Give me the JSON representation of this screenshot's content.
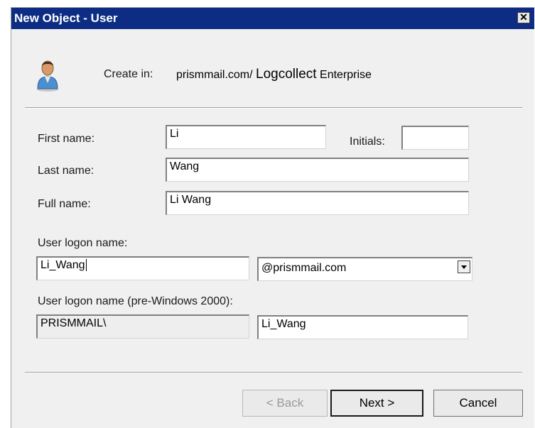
{
  "window": {
    "title": "New Object - User",
    "close_glyph": "✕"
  },
  "header": {
    "icon": "user-icon",
    "create_in_label": "Create in:",
    "path_prefix": "prismmail.com/",
    "path_ou": "Logcollect",
    "path_suffix": "Enterprise"
  },
  "form": {
    "first_name_label": "First name:",
    "first_name_value": "Li",
    "initials_label": "Initials:",
    "initials_value": "",
    "last_name_label": "Last name:",
    "last_name_value": "Wang",
    "full_name_label": "Full name:",
    "full_name_value": "Li Wang",
    "logon_name_label": "User logon name:",
    "logon_name_value": "Li_Wang",
    "domain_selected": "@prismmail.com",
    "pre2000_label": "User logon name (pre-Windows 2000):",
    "pre2000_domain_value": "PRISMMAIL\\",
    "pre2000_name_value": "Li_Wang"
  },
  "buttons": {
    "back_label": "< Back",
    "next_label": "Next >",
    "cancel_label": "Cancel"
  },
  "colors": {
    "titlebar": "#0c2d83",
    "dialog_bg": "#f0f0f0"
  }
}
